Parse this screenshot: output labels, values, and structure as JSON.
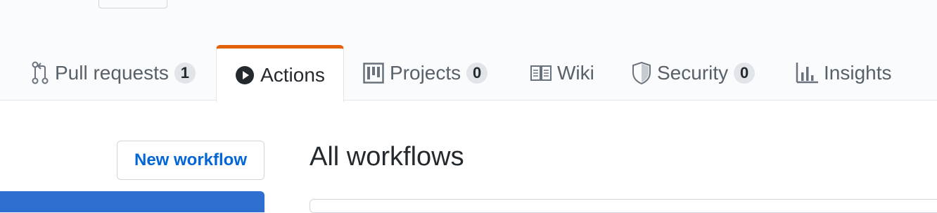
{
  "tabs": [
    {
      "label": "Pull requests",
      "count": "1",
      "icon": "git-pull-request-icon"
    },
    {
      "label": "Actions",
      "icon": "play-icon"
    },
    {
      "label": "Projects",
      "count": "0",
      "icon": "project-icon"
    },
    {
      "label": "Wiki",
      "icon": "book-icon"
    },
    {
      "label": "Security",
      "count": "0",
      "icon": "shield-icon"
    },
    {
      "label": "Insights",
      "icon": "graph-icon"
    }
  ],
  "selected_tab": "Actions",
  "sidebar": {
    "new_workflow_label": "New workflow"
  },
  "main": {
    "title": "All workflows"
  },
  "colors": {
    "accent_underline": "#e36209",
    "link_blue": "#0366d6",
    "sidebar_selected": "#2f6fcf"
  }
}
